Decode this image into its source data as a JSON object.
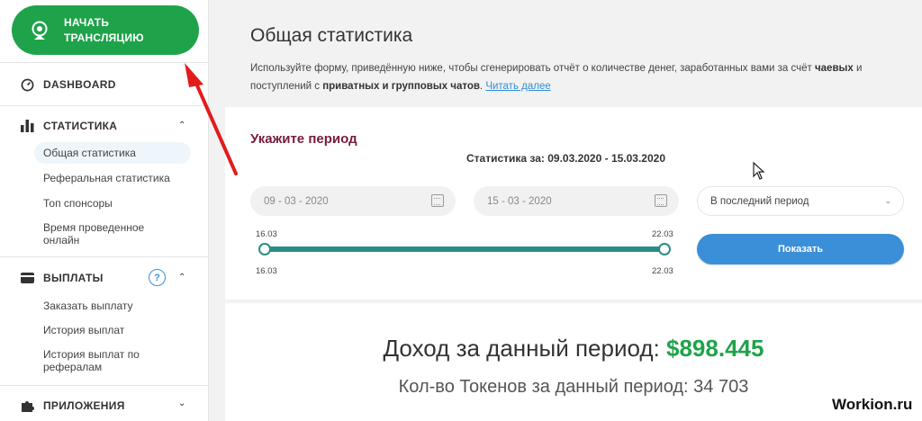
{
  "sidebar": {
    "start_button": "НАЧАТЬ ТРАНСЛЯЦИЮ",
    "dashboard": "DASHBOARD",
    "statistics": {
      "label": "СТАТИСТИКА",
      "items": [
        "Общая статистика",
        "Реферальная статистика",
        "Топ спонсоры",
        "Время проведенное онлайн"
      ]
    },
    "payouts": {
      "label": "ВЫПЛАТЫ",
      "help": "?",
      "items": [
        "Заказать выплату",
        "История выплат",
        "История выплат по рефералам"
      ]
    },
    "apps": "ПРИЛОЖЕНИЯ"
  },
  "main": {
    "title": "Общая статистика",
    "intro_1": "Используйте форму, приведённую ниже, чтобы сгенерировать отчёт о количестве денег, заработанных вами за счёт",
    "intro_b1": "чаевых",
    "intro_2": "и поступлений с",
    "intro_b2": "приватных и групповых чатов",
    "intro_link": "Читать далее",
    "period_title": "Укажите период",
    "range_text": "Статистика за: 09.03.2020 - 15.03.2020",
    "date_from": "09 - 03 - 2020",
    "date_to": "15 - 03 - 2020",
    "period_select": "В последний период",
    "slider": {
      "start_top": "16.03",
      "end_top": "22.03",
      "start_bottom": "16.03",
      "end_bottom": "22.03"
    },
    "show_button": "Показать",
    "income_label": "Доход за данный период:",
    "income_value": "$898.445",
    "tokens_text": "Кол-во Токенов за данный период: 34 703"
  },
  "watermark": "Workion.ru",
  "colors": {
    "green": "#1fa34a",
    "blue": "#3a8fd8",
    "teal": "#2a8d85",
    "maroon": "#7a1a3e",
    "arrow": "#e31b1b"
  },
  "icons": [
    "webcam-icon",
    "dashboard-gauge-icon",
    "bar-chart-icon",
    "wallet-icon",
    "puzzle-icon",
    "calendar-icon",
    "chevron-up-icon",
    "chevron-down-icon",
    "help-icon",
    "cursor-icon"
  ]
}
